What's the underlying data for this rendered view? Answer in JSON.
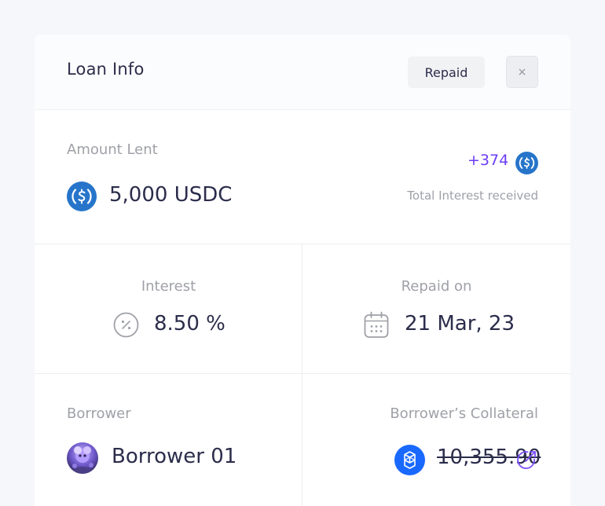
{
  "header": {
    "title": "Loan Info",
    "repaid_label": "Repaid",
    "close_glyph": "×"
  },
  "amount": {
    "label": "Amount Lent",
    "value": "5,000 USDC",
    "icon": "usdc-coin-icon",
    "interest_total": "+374",
    "interest_icon": "usdc-coin-icon",
    "interest_caption": "Total Interest received"
  },
  "interest": {
    "label": "Interest",
    "value": "8.50 %",
    "icon": "percent-icon"
  },
  "repaid_on": {
    "label": "Repaid on",
    "value": "21 Mar, 23",
    "icon": "calendar-icon"
  },
  "borrower": {
    "label": "Borrower",
    "name": "Borrower 01",
    "icon": "avatar"
  },
  "collateral": {
    "label": "Borrower’s Collateral",
    "value": "10,355.90",
    "icon": "fantom-token-icon",
    "link_icon": "external-link-icon"
  },
  "colors": {
    "accent": "#6b3df5",
    "usdc_blue": "#2775ca",
    "fantom_blue": "#1969ff",
    "text": "#2b2d4b",
    "muted": "#9fa1a8"
  }
}
